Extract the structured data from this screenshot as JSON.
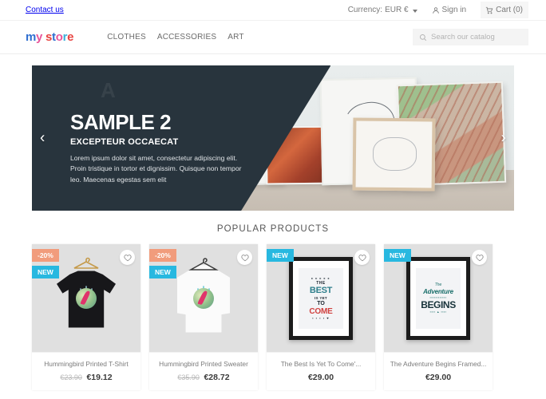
{
  "topbar": {
    "contact": "Contact us",
    "currency_label": "Currency:",
    "currency_value": "EUR €",
    "signin": "Sign in",
    "cart": "Cart (0)"
  },
  "header": {
    "logo": {
      "part1": "m",
      "part2": "y",
      "part3": "s",
      "part4": "t",
      "part5": "o",
      "part6": "r",
      "part7": "e"
    },
    "nav": [
      {
        "label": "CLOTHES"
      },
      {
        "label": "ACCESSORIES"
      },
      {
        "label": "ART"
      }
    ],
    "search": {
      "placeholder": "Search our catalog",
      "value": ""
    }
  },
  "banner": {
    "title": "SAMPLE 2",
    "subtitle": "EXCEPTEUR OCCAECAT",
    "description": "Lorem ipsum dolor sit amet, consectetur adipiscing elit. Proin tristique in tortor et dignissim. Quisque non tempor leo. Maecenas egestas sem elit",
    "prev_arrow": "‹",
    "next_arrow": "›",
    "bg_letter": "A"
  },
  "products_section": {
    "title": "POPULAR PRODUCTS",
    "items": [
      {
        "name": "Hummingbird Printed T-Shirt",
        "old_price": "€23.90",
        "price": "€19.12",
        "badges": [
          {
            "text": "-20%",
            "type": "discount"
          },
          {
            "text": "NEW",
            "type": "new"
          }
        ],
        "art": "tshirt-black"
      },
      {
        "name": "Hummingbird Printed Sweater",
        "old_price": "€35.90",
        "price": "€28.72",
        "badges": [
          {
            "text": "-20%",
            "type": "discount"
          },
          {
            "text": "NEW",
            "type": "new"
          }
        ],
        "art": "sweater-white"
      },
      {
        "name": "The Best Is Yet To Come'...",
        "old_price": "",
        "price": "€29.00",
        "badges": [
          {
            "text": "NEW",
            "type": "new"
          }
        ],
        "art": "poster-best",
        "poster_lines": {
          "the": "THE",
          "best": "BEST",
          "isyet": "IS YET",
          "to": "TO",
          "come": "COME"
        }
      },
      {
        "name": "The Adventure Begins Framed...",
        "old_price": "",
        "price": "€29.00",
        "badges": [
          {
            "text": "NEW",
            "type": "new"
          }
        ],
        "art": "poster-adventure",
        "poster_lines": {
          "the": "The",
          "adventure": "Adventure",
          "begins": "BEGINS"
        }
      }
    ]
  },
  "colors": {
    "badge_discount": "#f19c7c",
    "badge_new": "#28b8e0",
    "banner_dark": "#28343d",
    "logo_blue": "#2f6fd0",
    "logo_pink": "#e8569a",
    "logo_red": "#e8423f"
  }
}
